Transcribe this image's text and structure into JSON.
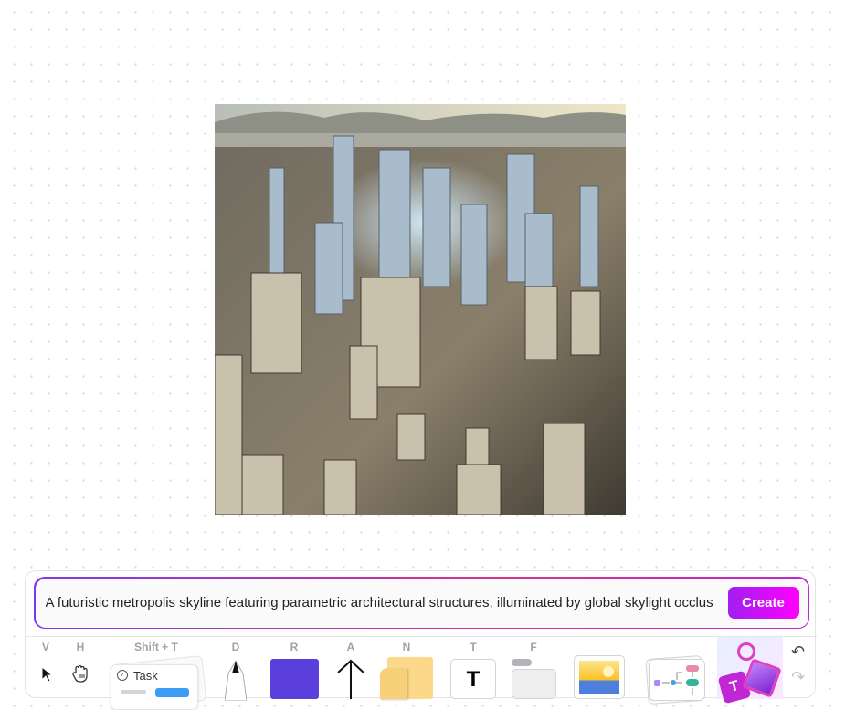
{
  "prompt": {
    "value": "A futuristic metropolis skyline featuring parametric architectural structures, illuminated by global skylight occlus",
    "create_label": "Create"
  },
  "tools": [
    {
      "key": "V",
      "name": "select"
    },
    {
      "key": "H",
      "name": "hand"
    },
    {
      "key": "Shift + T",
      "name": "task",
      "label": "Task"
    },
    {
      "key": "D",
      "name": "draw"
    },
    {
      "key": "R",
      "name": "rectangle",
      "color": "#5b3fdc"
    },
    {
      "key": "A",
      "name": "arrow"
    },
    {
      "key": "N",
      "name": "sticky-note",
      "color": "#fcd98a"
    },
    {
      "key": "T",
      "name": "text",
      "label": "T"
    },
    {
      "key": "F",
      "name": "frame"
    },
    {
      "key": "",
      "name": "image"
    },
    {
      "key": "",
      "name": "templates"
    },
    {
      "key": "",
      "name": "ai-generate"
    }
  ]
}
